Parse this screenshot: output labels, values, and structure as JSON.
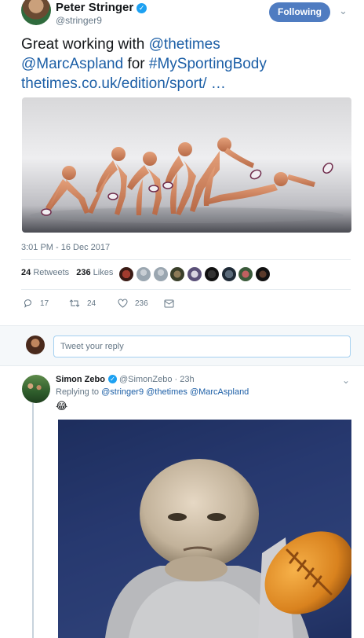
{
  "tweet": {
    "author_name": "Peter Stringer",
    "author_handle": "@stringer9",
    "follow_label": "Following",
    "text_line1_prefix": "Great working with ",
    "text_line1_mention": "@thetimes",
    "text_line2_mention": "@MarcAspland",
    "text_line2_mid": " for ",
    "text_line2_hashtag": "#MySportingBody",
    "text_line3_link": "thetimes.co.uk/edition/sport/",
    "text_line3_ellipsis": "  …",
    "timestamp": "3:01 PM - 16 Dec 2017",
    "retweets_count": "24",
    "retweets_label": "Retweets",
    "likes_count": "236",
    "likes_label": "Likes",
    "actions": {
      "reply_count": "17",
      "retweet_count": "24",
      "like_count": "236"
    }
  },
  "reply_composer": {
    "placeholder": "Tweet your reply"
  },
  "reply": {
    "author_name": "Simon Zebo",
    "author_handle": "@SimonZebo",
    "age": "· 23h",
    "replying_to_label": "Replying to ",
    "replying_to_1": "@stringer9",
    "replying_to_2": "@thetimes",
    "replying_to_3": "@MarcAspland",
    "emoji": "😂"
  },
  "colors": {
    "accent_blue": "#1da1f2",
    "link_blue": "#1b5ea6",
    "follow_button": "#4f7cc1",
    "muted_text": "#657786"
  },
  "icons": [
    "verified-badge-icon",
    "chevron-down-icon",
    "reply-icon",
    "retweet-icon",
    "heart-icon",
    "message-icon"
  ]
}
